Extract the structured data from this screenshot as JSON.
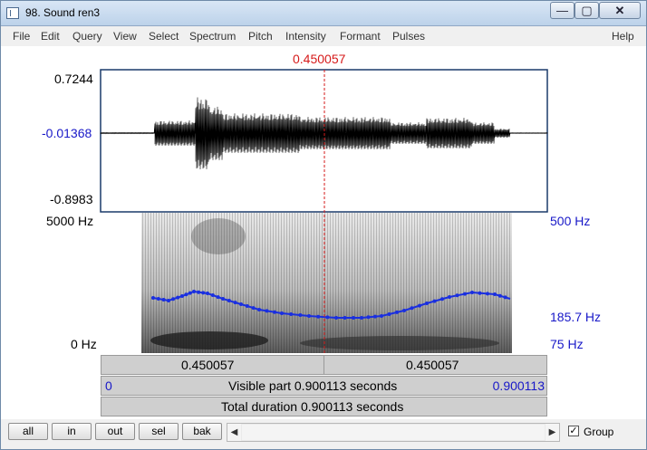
{
  "window": {
    "title": "98. Sound ren3"
  },
  "controls": {
    "minimize": "—",
    "maximize": "▢",
    "close": "✕"
  },
  "menu": [
    "File",
    "Edit",
    "Query",
    "View",
    "Select",
    "Spectrum",
    "Pitch",
    "Intensity",
    "Formant",
    "Pulses",
    "Help"
  ],
  "cursor": {
    "time_label": "0.450057"
  },
  "waveform": {
    "max": "0.7244",
    "cursor_value": "-0.01368",
    "min": "-0.8983"
  },
  "spectrogram": {
    "top_freq": "5000 Hz",
    "bottom_freq": "0 Hz"
  },
  "pitch": {
    "top": "500 Hz",
    "current": "185.7 Hz",
    "bottom": "75 Hz"
  },
  "ruler": {
    "left_segment": "0.450057",
    "right_segment": "0.450057",
    "start": "0",
    "visible_part": "Visible part 0.900113 seconds",
    "end": "0.900113",
    "total": "Total duration 0.900113 seconds"
  },
  "buttons": {
    "all": "all",
    "in": "in",
    "out": "out",
    "sel": "sel",
    "bak": "bak"
  },
  "scrollbar": {
    "left_arrow": "◀",
    "right_arrow": "▶"
  },
  "group": {
    "label": "Group",
    "checked": true,
    "check_mark": "✓"
  },
  "colors": {
    "pitch_line": "#1a2fe0",
    "cursor": "#d61a1a",
    "axis_blue": "#1818c8",
    "frame": "#1a3a6a"
  }
}
